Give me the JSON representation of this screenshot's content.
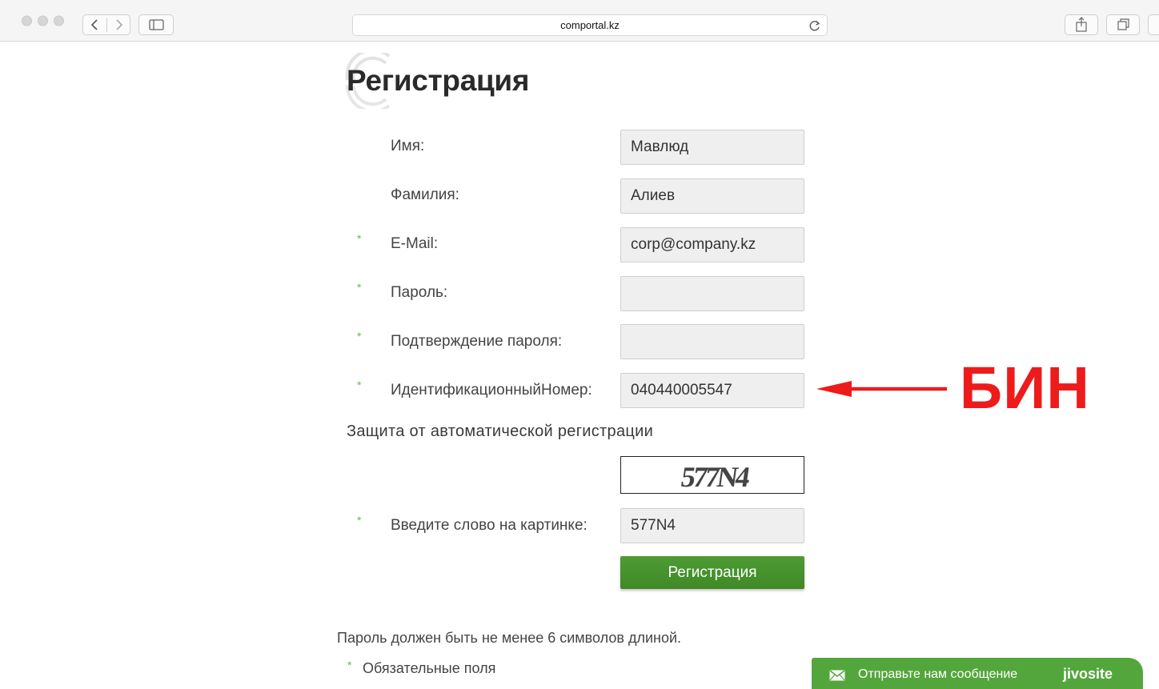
{
  "browser": {
    "url": "comportal.kz"
  },
  "page": {
    "title": "Регистрация",
    "fields": [
      {
        "label": "Имя:",
        "value": "Мавлюд",
        "required": false
      },
      {
        "label": "Фамилия:",
        "value": "Алиев",
        "required": false
      },
      {
        "label": "E-Mail:",
        "value": "corp@company.kz",
        "required": true
      },
      {
        "label": "Пароль:",
        "value": "",
        "required": true
      },
      {
        "label": "Подтверждение пароля:",
        "value": "",
        "required": true
      },
      {
        "label": "ИдентификационныйНомер:",
        "value": "040440005547",
        "required": true
      }
    ],
    "required_mark": "*",
    "captcha_heading": "Защита от автоматической регистрации",
    "captcha_image_text": "577N4",
    "captcha_label": "Введите слово на картинке:",
    "captcha_value": "577N4",
    "submit_label": "Регистрация",
    "password_note": "Пароль должен быть не менее 6 символов длиной.",
    "required_note": "Обязательные поля"
  },
  "annotation": {
    "label": "БИН",
    "color": "#ee1b1b"
  },
  "chat": {
    "text": "Отправьте нам сообщение",
    "brand": "jivosite",
    "color": "#53a63c"
  }
}
